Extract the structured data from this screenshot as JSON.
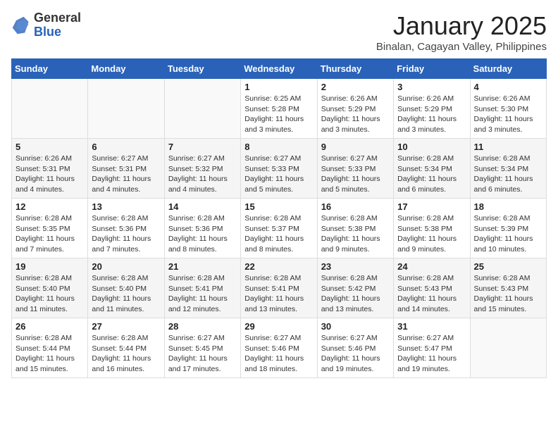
{
  "header": {
    "logo_general": "General",
    "logo_blue": "Blue",
    "title": "January 2025",
    "location": "Binalan, Cagayan Valley, Philippines"
  },
  "weekdays": [
    "Sunday",
    "Monday",
    "Tuesday",
    "Wednesday",
    "Thursday",
    "Friday",
    "Saturday"
  ],
  "weeks": [
    [
      {
        "day": "",
        "info": ""
      },
      {
        "day": "",
        "info": ""
      },
      {
        "day": "",
        "info": ""
      },
      {
        "day": "1",
        "info": "Sunrise: 6:25 AM\nSunset: 5:28 PM\nDaylight: 11 hours\nand 3 minutes."
      },
      {
        "day": "2",
        "info": "Sunrise: 6:26 AM\nSunset: 5:29 PM\nDaylight: 11 hours\nand 3 minutes."
      },
      {
        "day": "3",
        "info": "Sunrise: 6:26 AM\nSunset: 5:29 PM\nDaylight: 11 hours\nand 3 minutes."
      },
      {
        "day": "4",
        "info": "Sunrise: 6:26 AM\nSunset: 5:30 PM\nDaylight: 11 hours\nand 3 minutes."
      }
    ],
    [
      {
        "day": "5",
        "info": "Sunrise: 6:26 AM\nSunset: 5:31 PM\nDaylight: 11 hours\nand 4 minutes."
      },
      {
        "day": "6",
        "info": "Sunrise: 6:27 AM\nSunset: 5:31 PM\nDaylight: 11 hours\nand 4 minutes."
      },
      {
        "day": "7",
        "info": "Sunrise: 6:27 AM\nSunset: 5:32 PM\nDaylight: 11 hours\nand 4 minutes."
      },
      {
        "day": "8",
        "info": "Sunrise: 6:27 AM\nSunset: 5:33 PM\nDaylight: 11 hours\nand 5 minutes."
      },
      {
        "day": "9",
        "info": "Sunrise: 6:27 AM\nSunset: 5:33 PM\nDaylight: 11 hours\nand 5 minutes."
      },
      {
        "day": "10",
        "info": "Sunrise: 6:28 AM\nSunset: 5:34 PM\nDaylight: 11 hours\nand 6 minutes."
      },
      {
        "day": "11",
        "info": "Sunrise: 6:28 AM\nSunset: 5:34 PM\nDaylight: 11 hours\nand 6 minutes."
      }
    ],
    [
      {
        "day": "12",
        "info": "Sunrise: 6:28 AM\nSunset: 5:35 PM\nDaylight: 11 hours\nand 7 minutes."
      },
      {
        "day": "13",
        "info": "Sunrise: 6:28 AM\nSunset: 5:36 PM\nDaylight: 11 hours\nand 7 minutes."
      },
      {
        "day": "14",
        "info": "Sunrise: 6:28 AM\nSunset: 5:36 PM\nDaylight: 11 hours\nand 8 minutes."
      },
      {
        "day": "15",
        "info": "Sunrise: 6:28 AM\nSunset: 5:37 PM\nDaylight: 11 hours\nand 8 minutes."
      },
      {
        "day": "16",
        "info": "Sunrise: 6:28 AM\nSunset: 5:38 PM\nDaylight: 11 hours\nand 9 minutes."
      },
      {
        "day": "17",
        "info": "Sunrise: 6:28 AM\nSunset: 5:38 PM\nDaylight: 11 hours\nand 9 minutes."
      },
      {
        "day": "18",
        "info": "Sunrise: 6:28 AM\nSunset: 5:39 PM\nDaylight: 11 hours\nand 10 minutes."
      }
    ],
    [
      {
        "day": "19",
        "info": "Sunrise: 6:28 AM\nSunset: 5:40 PM\nDaylight: 11 hours\nand 11 minutes."
      },
      {
        "day": "20",
        "info": "Sunrise: 6:28 AM\nSunset: 5:40 PM\nDaylight: 11 hours\nand 11 minutes."
      },
      {
        "day": "21",
        "info": "Sunrise: 6:28 AM\nSunset: 5:41 PM\nDaylight: 11 hours\nand 12 minutes."
      },
      {
        "day": "22",
        "info": "Sunrise: 6:28 AM\nSunset: 5:41 PM\nDaylight: 11 hours\nand 13 minutes."
      },
      {
        "day": "23",
        "info": "Sunrise: 6:28 AM\nSunset: 5:42 PM\nDaylight: 11 hours\nand 13 minutes."
      },
      {
        "day": "24",
        "info": "Sunrise: 6:28 AM\nSunset: 5:43 PM\nDaylight: 11 hours\nand 14 minutes."
      },
      {
        "day": "25",
        "info": "Sunrise: 6:28 AM\nSunset: 5:43 PM\nDaylight: 11 hours\nand 15 minutes."
      }
    ],
    [
      {
        "day": "26",
        "info": "Sunrise: 6:28 AM\nSunset: 5:44 PM\nDaylight: 11 hours\nand 15 minutes."
      },
      {
        "day": "27",
        "info": "Sunrise: 6:28 AM\nSunset: 5:44 PM\nDaylight: 11 hours\nand 16 minutes."
      },
      {
        "day": "28",
        "info": "Sunrise: 6:27 AM\nSunset: 5:45 PM\nDaylight: 11 hours\nand 17 minutes."
      },
      {
        "day": "29",
        "info": "Sunrise: 6:27 AM\nSunset: 5:46 PM\nDaylight: 11 hours\nand 18 minutes."
      },
      {
        "day": "30",
        "info": "Sunrise: 6:27 AM\nSunset: 5:46 PM\nDaylight: 11 hours\nand 19 minutes."
      },
      {
        "day": "31",
        "info": "Sunrise: 6:27 AM\nSunset: 5:47 PM\nDaylight: 11 hours\nand 19 minutes."
      },
      {
        "day": "",
        "info": ""
      }
    ]
  ]
}
